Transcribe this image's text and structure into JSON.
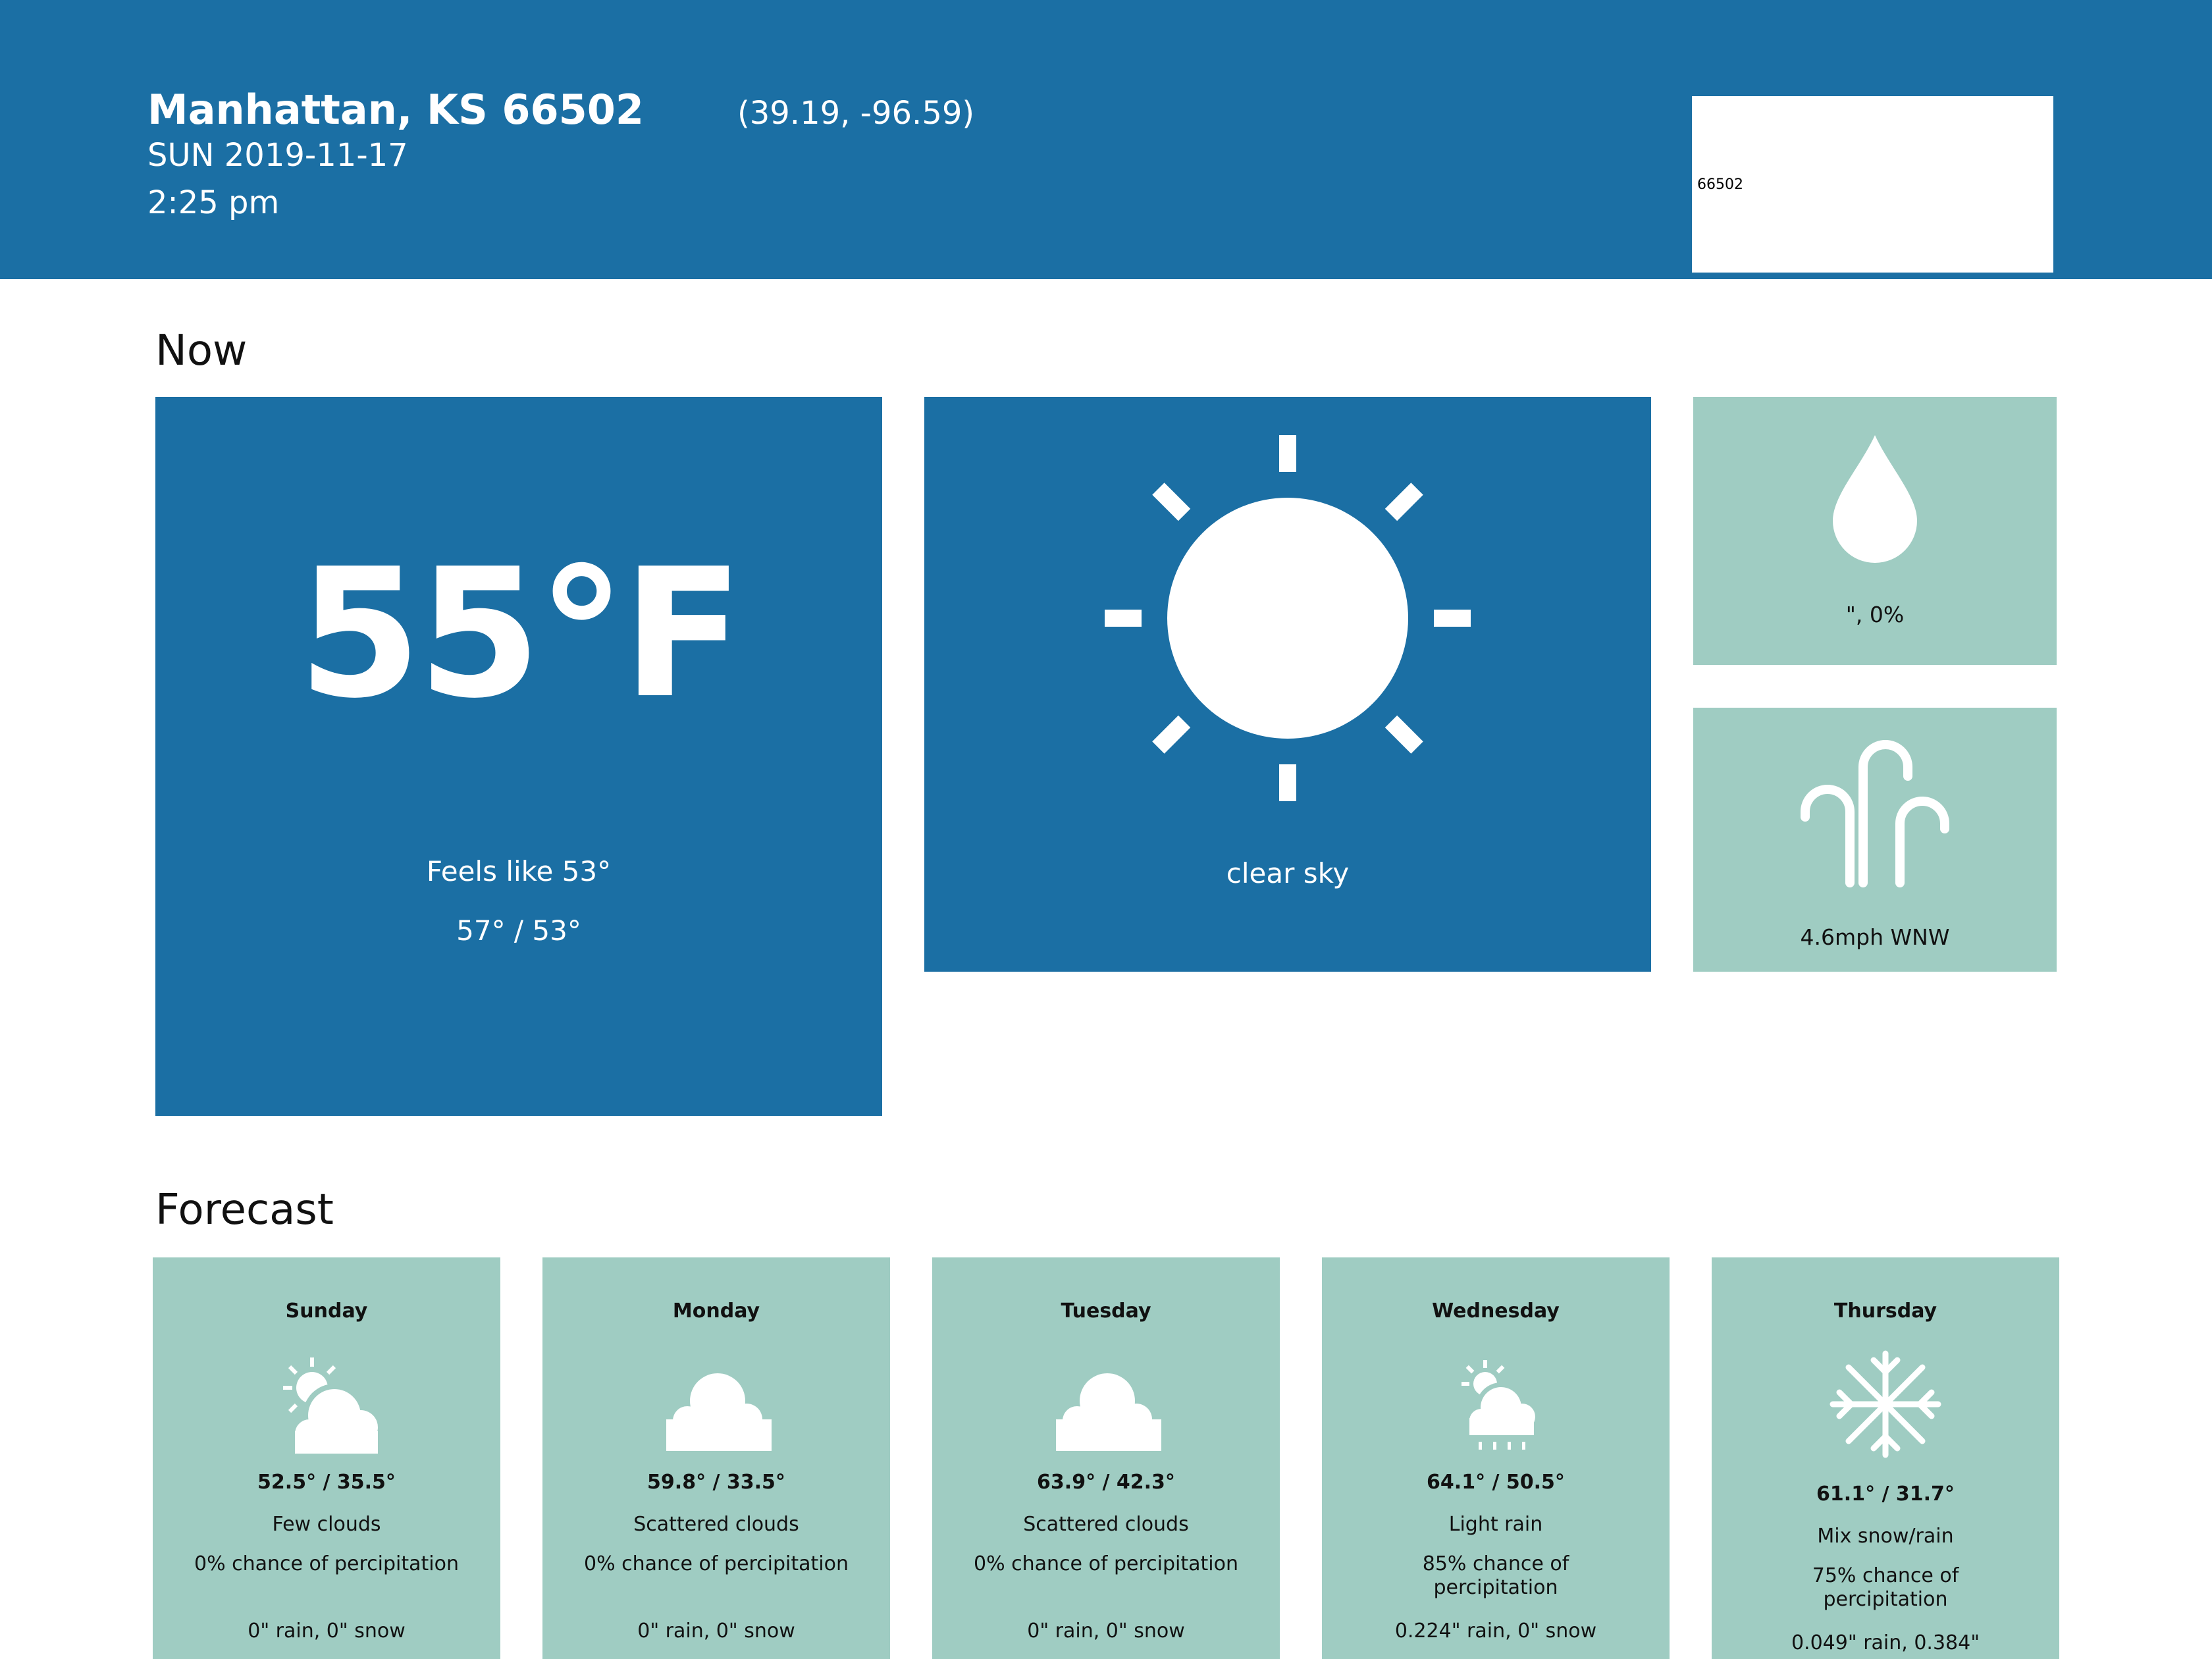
{
  "header": {
    "location": "Manhattan, KS 66502",
    "coords": "(39.19, -96.59)",
    "date": "SUN 2019-11-17",
    "time": "2:25 pm",
    "search_value": "66502"
  },
  "now": {
    "title": "Now",
    "temperature": "55°F",
    "feels_like": "Feels like 53°",
    "hi_lo": "57° / 53°",
    "condition": "clear sky",
    "condition_icon": "sun-icon",
    "precipitation": "\", 0%",
    "precipitation_icon": "drop-icon",
    "wind": "4.6mph WNW",
    "wind_icon": "wind-icon"
  },
  "forecast": {
    "title": "Forecast",
    "days": [
      {
        "day": "Sunday",
        "icon": "partly-cloudy-icon",
        "temps": "52.5° / 35.5°",
        "description": "Few clouds",
        "chance": "0% chance of percipitation",
        "amount": "0\" rain, 0\" snow"
      },
      {
        "day": "Monday",
        "icon": "cloud-icon",
        "temps": "59.8° / 33.5°",
        "description": "Scattered clouds",
        "chance": "0% chance of percipitation",
        "amount": "0\" rain, 0\" snow"
      },
      {
        "day": "Tuesday",
        "icon": "cloud-icon",
        "temps": "63.9° / 42.3°",
        "description": "Scattered clouds",
        "chance": "0% chance of percipitation",
        "amount": "0\" rain, 0\" snow"
      },
      {
        "day": "Wednesday",
        "icon": "light-rain-icon",
        "temps": "64.1° / 50.5°",
        "description": "Light rain",
        "chance": "85% chance of percipitation",
        "amount": "0.224\" rain, 0\" snow"
      },
      {
        "day": "Thursday",
        "icon": "snowflake-icon",
        "temps": "61.1° / 31.7°",
        "description": "Mix snow/rain",
        "chance": "75% chance of percipitation",
        "amount": "0.049\" rain, 0.384\""
      }
    ]
  },
  "colors": {
    "primary_blue": "#1b6fa4",
    "tile_green": "#9fccc2",
    "background": "#ffffff"
  }
}
